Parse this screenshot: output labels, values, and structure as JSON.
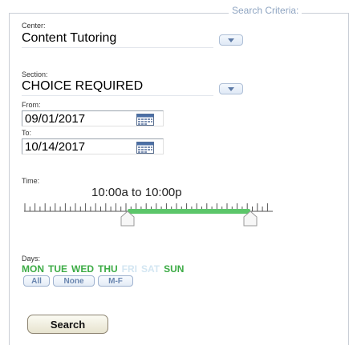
{
  "search_criteria": {
    "legend": "Search Criteria:",
    "center": {
      "label": "Center:",
      "value": "Content Tutoring"
    },
    "section": {
      "label": "Section:",
      "value": "CHOICE REQUIRED"
    },
    "from": {
      "label": "From:",
      "value": "09/01/2017"
    },
    "to": {
      "label": "To:",
      "value": "10/14/2017"
    },
    "time": {
      "label": "Time:",
      "range_text": "10:00a to 10:00p",
      "start_fraction": 0.42,
      "end_fraction": 0.92
    },
    "days": {
      "label": "Days:",
      "items": [
        {
          "label": "MON",
          "selected": true
        },
        {
          "label": "TUE",
          "selected": true
        },
        {
          "label": "WED",
          "selected": true
        },
        {
          "label": "THU",
          "selected": true
        },
        {
          "label": "FRI",
          "selected": false
        },
        {
          "label": "SAT",
          "selected": false
        },
        {
          "label": "SUN",
          "selected": true
        }
      ],
      "buttons": {
        "all": "All",
        "none": "None",
        "weekdays": "M-F"
      }
    },
    "search_button": "Search"
  },
  "colors": {
    "selected_day": "#3cab45",
    "unselected_day": "#d3e6f2",
    "range_bar": "#5cc66a",
    "legend": "#8fa5c2"
  },
  "icons": {
    "dropdown": "chevron-down-icon",
    "calendar": "calendar-icon"
  }
}
